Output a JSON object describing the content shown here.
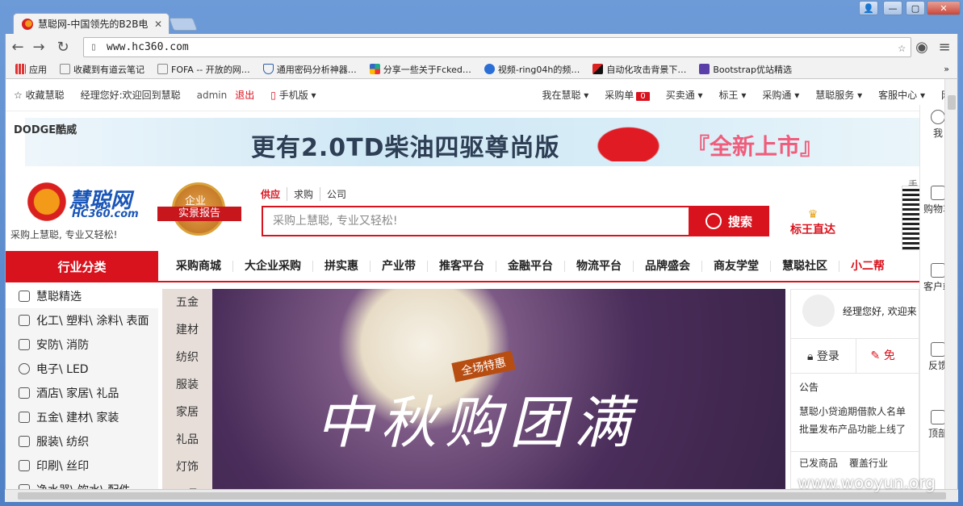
{
  "browser": {
    "tab_title": "慧聪网-中国领先的B2B电",
    "url": "www.hc360.com",
    "bookmarks": [
      {
        "label": "应用"
      },
      {
        "label": "收藏到有道云笔记"
      },
      {
        "label": "FOFA -- 开放的网…"
      },
      {
        "label": "通用密码分析神器…"
      },
      {
        "label": "分享一些关于Fcked…"
      },
      {
        "label": "视频-ring04h的频…"
      },
      {
        "label": "自动化攻击背景下…"
      },
      {
        "label": "Bootstrap优站精选"
      }
    ],
    "more": "»"
  },
  "topbar": {
    "fav": "收藏慧聪",
    "welcome": "经理您好:欢迎回到慧聪",
    "user": "admin",
    "logout": "退出",
    "mobile": "手机版",
    "my": "我在慧聪",
    "cart": "采购单",
    "cart_count": "0",
    "trade": "买卖通",
    "biaowang": "标王",
    "purchase": "采购通",
    "service": "慧聪服务",
    "support": "客服中心",
    "nav_more": "网"
  },
  "banner": {
    "brand": "DODGE酷威",
    "headline": "更有2.0TD柴油四驱尊尚版",
    "new": "『全新上市』"
  },
  "logo": {
    "name": "慧聪网",
    "en": "HC360.com",
    "slogan": "采购上慧聪, 专业又轻松!"
  },
  "seal": {
    "top": "企业",
    "ribbon": "实景报告"
  },
  "search": {
    "tabs": [
      "供应",
      "求购",
      "公司"
    ],
    "placeholder": "采购上慧聪, 专业又轻松!",
    "button": "搜索"
  },
  "biaowang_link": "标王直达",
  "qr_label": "手",
  "nav": {
    "category": "行业分类",
    "items": [
      "采购商城",
      "大企业采购",
      "拼实惠",
      "产业带",
      "推客平台",
      "金融平台",
      "物流平台",
      "品牌盛会",
      "商友学堂",
      "慧聪社区"
    ],
    "hot": "小二帮"
  },
  "sidebar": [
    "慧聪精选",
    "化工\\ 塑料\\ 涂料\\ 表面",
    "安防\\ 消防",
    "电子\\ LED",
    "酒店\\ 家居\\ 礼品",
    "五金\\ 建材\\ 家装",
    "服装\\ 纺织",
    "印刷\\ 丝印",
    "净水器\\ 饮水\\ 配件"
  ],
  "hero": {
    "tags": [
      "五金",
      "建材",
      "纺织",
      "服装",
      "家居",
      "礼品",
      "灯饰",
      "工具"
    ],
    "promo": "全场特惠",
    "headline": "中秋购团满"
  },
  "right_panel": {
    "greeting": "经理您好, 欢迎来",
    "login": "登录",
    "free": "免",
    "notice": "公告",
    "news": [
      "慧聪小贷逾期借款人名单",
      "批量发布产品功能上线了"
    ],
    "tabs": [
      "已发商品",
      "覆盖行业"
    ]
  },
  "rail": [
    "我",
    "购物车",
    "客户端",
    "反馈",
    "顶部"
  ],
  "watermark": "www.wooyun.org"
}
